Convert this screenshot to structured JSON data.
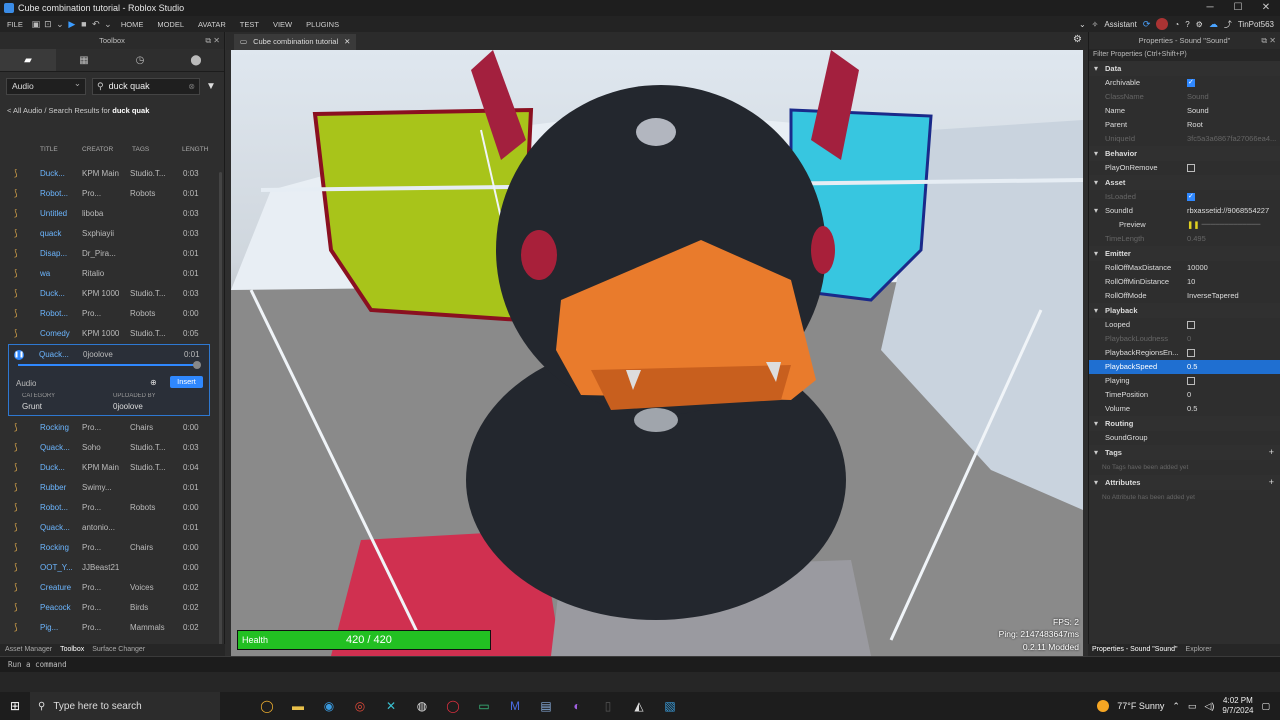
{
  "window": {
    "title": "Cube combination tutorial - Roblox Studio"
  },
  "ribbon": {
    "menus": [
      "FILE",
      "HOME",
      "MODEL",
      "AVATAR",
      "TEST",
      "VIEW",
      "PLUGINS"
    ],
    "assistant_label": "Assistant",
    "username": "TinPot563"
  },
  "toolbox": {
    "header": "Toolbox",
    "category": "Audio",
    "search_value": "duck quak",
    "breadcrumb_prefix": "< All Audio / Search Results for ",
    "breadcrumb_query": "duck quak",
    "columns": [
      "TITLE",
      "CREATOR",
      "TAGS",
      "LENGTH"
    ],
    "rows_before": [
      {
        "title": "Duck...",
        "creator": "KPM Main",
        "tags": "Studio.T...",
        "length": "0:03"
      },
      {
        "title": "Robot...",
        "creator": "Pro...",
        "tags": "Robots",
        "length": "0:01"
      },
      {
        "title": "Untitled",
        "creator": "liboba",
        "tags": "",
        "length": "0:03"
      },
      {
        "title": "quack",
        "creator": "Sxphiayii",
        "tags": "",
        "length": "0:03"
      },
      {
        "title": "Disap...",
        "creator": "Dr_Pira...",
        "tags": "",
        "length": "0:01"
      },
      {
        "title": "wa",
        "creator": "Ritalio",
        "tags": "",
        "length": "0:01"
      },
      {
        "title": "Duck...",
        "creator": "KPM 1000",
        "tags": "Studio.T...",
        "length": "0:03"
      },
      {
        "title": "Robot...",
        "creator": "Pro...",
        "tags": "Robots",
        "length": "0:00"
      },
      {
        "title": "Comedy",
        "creator": "KPM 1000",
        "tags": "Studio.T...",
        "length": "0:05"
      }
    ],
    "selected": {
      "title": "Quack...",
      "creator": "0joolove",
      "length": "0:01",
      "type_label": "Audio",
      "insert_label": "Insert",
      "category_label": "CATEGORY",
      "category_value": "Grunt",
      "uploaded_label": "UPLOADED BY",
      "uploaded_value": "0joolove",
      "progress": 0.98
    },
    "rows_after": [
      {
        "title": "Rocking",
        "creator": "Pro...",
        "tags": "Chairs",
        "length": "0:00"
      },
      {
        "title": "Quack...",
        "creator": "Soho",
        "tags": "Studio.T...",
        "length": "0:03"
      },
      {
        "title": "Duck...",
        "creator": "KPM Main",
        "tags": "Studio.T...",
        "length": "0:04"
      },
      {
        "title": "Rubber",
        "creator": "Swimy...",
        "tags": "",
        "length": "0:01"
      },
      {
        "title": "Robot...",
        "creator": "Pro...",
        "tags": "Robots",
        "length": "0:00"
      },
      {
        "title": "Quack...",
        "creator": "antonio...",
        "tags": "",
        "length": "0:01"
      },
      {
        "title": "Rocking",
        "creator": "Pro...",
        "tags": "Chairs",
        "length": "0:00"
      },
      {
        "title": "OOT_Y...",
        "creator": "JJBeast21",
        "tags": "",
        "length": "0:00"
      },
      {
        "title": "Creature",
        "creator": "Pro...",
        "tags": "Voices",
        "length": "0:02"
      },
      {
        "title": "Peacock",
        "creator": "Pro...",
        "tags": "Birds",
        "length": "0:02"
      },
      {
        "title": "Pig...",
        "creator": "Pro...",
        "tags": "Mammals",
        "length": "0:02"
      }
    ],
    "bottom_tabs": [
      "Asset Manager",
      "Toolbox",
      "Surface Changer"
    ]
  },
  "viewport": {
    "tab_label": "Cube combination tutorial",
    "health_label": "Health",
    "health_value": "420 / 420",
    "health_fraction": 1.0,
    "fps": "FPS: 2",
    "ping": "Ping: 2147483647ms",
    "version": "0.2.11 Modded"
  },
  "properties": {
    "header": "Properties - Sound \"Sound\"",
    "filter_placeholder": "Filter Properties (Ctrl+Shift+P)",
    "sections": {
      "data": "Data",
      "behavior": "Behavior",
      "asset": "Asset",
      "emitter": "Emitter",
      "playback": "Playback",
      "routing": "Routing",
      "tags": "Tags",
      "attributes": "Attributes"
    },
    "data_rows": {
      "archivable": "Archivable",
      "classname": "ClassName",
      "classname_value": "Sound",
      "name": "Name",
      "name_value": "Sound",
      "parent": "Parent",
      "parent_value": "Root",
      "uniqueid": "UniqueId",
      "uniqueid_value": "3fc5a3a6867fa27066ea4..."
    },
    "behavior_rows": {
      "playonremove": "PlayOnRemove"
    },
    "asset_rows": {
      "isloaded": "IsLoaded",
      "soundid": "SoundId",
      "soundid_value": "rbxassetid://9068554227",
      "preview": "Preview",
      "timelength": "TimeLength",
      "timelength_value": "0.495"
    },
    "emitter_rows": {
      "rollmax": "RollOffMaxDistance",
      "rollmax_value": "10000",
      "rollmin": "RollOffMinDistance",
      "rollmin_value": "10",
      "rollmode": "RollOffMode",
      "rollmode_value": "InverseTapered"
    },
    "playback_rows": {
      "looped": "Looped",
      "loudness": "PlaybackLoudness",
      "loudness_value": "0",
      "regions": "PlaybackRegionsEn...",
      "speed": "PlaybackSpeed",
      "speed_value": "0.5",
      "playing": "Playing",
      "timeposition": "TimePosition",
      "timeposition_value": "0",
      "volume": "Volume",
      "volume_value": "0.5"
    },
    "routing_rows": {
      "soundgroup": "SoundGroup"
    },
    "tags_note": "No Tags have been added yet",
    "attributes_note": "No Attribute has been added yet",
    "bottom_tabs": [
      "Properties - Sound \"Sound\"",
      "Explorer"
    ]
  },
  "command_bar": {
    "placeholder": "Run a command"
  },
  "taskbar": {
    "search_placeholder": "Type here to search",
    "weather": "77°F  Sunny",
    "time": "4:02 PM",
    "date": "9/7/2024"
  },
  "colors": {
    "accent": "#2f88ff",
    "health": "#22c022",
    "selection": "#1f6fd1"
  }
}
